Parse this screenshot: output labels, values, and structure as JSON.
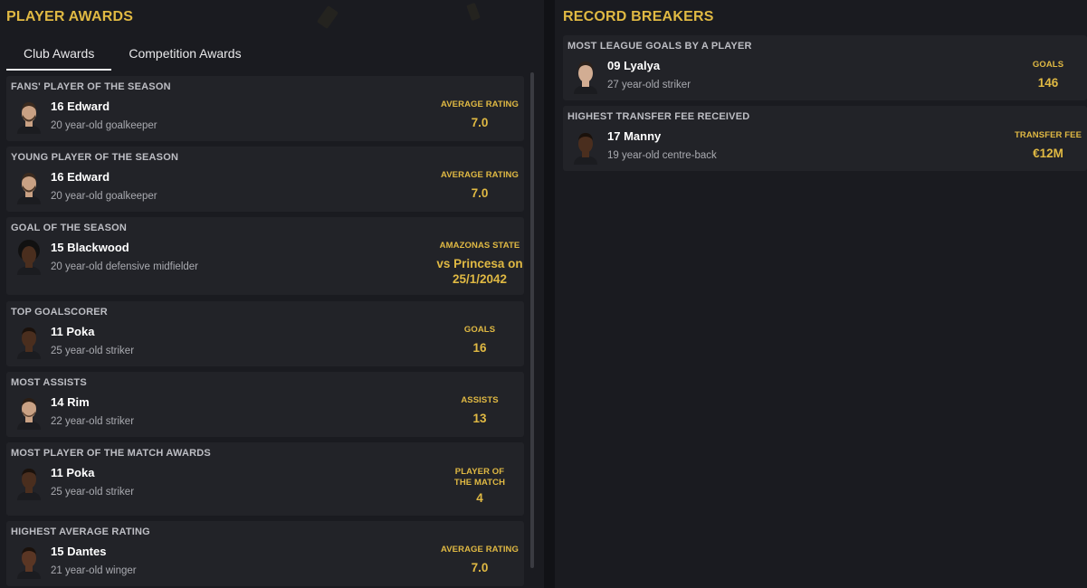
{
  "player_awards": {
    "title": "PLAYER AWARDS",
    "tabs": [
      "Club Awards",
      "Competition Awards"
    ],
    "cards": [
      {
        "title": "FANS' PLAYER OF THE SEASON",
        "name": "16 Edward",
        "desc": "20 year-old goalkeeper",
        "stat_label": "AVERAGE RATING",
        "stat_value": "7.0"
      },
      {
        "title": "YOUNG PLAYER OF THE SEASON",
        "name": "16 Edward",
        "desc": "20 year-old goalkeeper",
        "stat_label": "AVERAGE RATING",
        "stat_value": "7.0"
      },
      {
        "title": "GOAL OF THE SEASON",
        "name": "15 Blackwood",
        "desc": "20 year-old defensive midfielder",
        "stat_label": "AMAZONAS STATE",
        "stat_value": "vs Princesa on 25/1/2042"
      },
      {
        "title": "TOP GOALSCORER",
        "name": "11 Poka",
        "desc": "25 year-old striker",
        "stat_label": "GOALS",
        "stat_value": "16"
      },
      {
        "title": "MOST ASSISTS",
        "name": "14 Rim",
        "desc": "22 year-old striker",
        "stat_label": "ASSISTS",
        "stat_value": "13"
      },
      {
        "title": "MOST PLAYER OF THE MATCH AWARDS",
        "name": "11 Poka",
        "desc": "25 year-old striker",
        "stat_label": "PLAYER OF THE MATCH",
        "stat_value": "4"
      },
      {
        "title": "HIGHEST AVERAGE RATING",
        "name": "15 Dantes",
        "desc": "21 year-old winger",
        "stat_label": "AVERAGE RATING",
        "stat_value": "7.0"
      }
    ]
  },
  "record_breakers": {
    "title": "RECORD BREAKERS",
    "cards": [
      {
        "title": "MOST LEAGUE GOALS BY A PLAYER",
        "name": "09 Lyalya",
        "desc": "27 year-old striker",
        "stat_label": "GOALS",
        "stat_value": "146"
      },
      {
        "title": "HIGHEST TRANSFER FEE RECEIVED",
        "name": "17 Manny",
        "desc": "19 year-old centre-back",
        "stat_label": "TRANSFER FEE",
        "stat_value": "€12M"
      }
    ]
  },
  "colors": {
    "accent": "#e0b943",
    "panel": "#1a1b20",
    "card": "#222328",
    "background": "#111216"
  },
  "avatar_tones": {
    "light": "#c9a184",
    "medium": "#8a5a3c",
    "dark": "#4a2e1e"
  }
}
